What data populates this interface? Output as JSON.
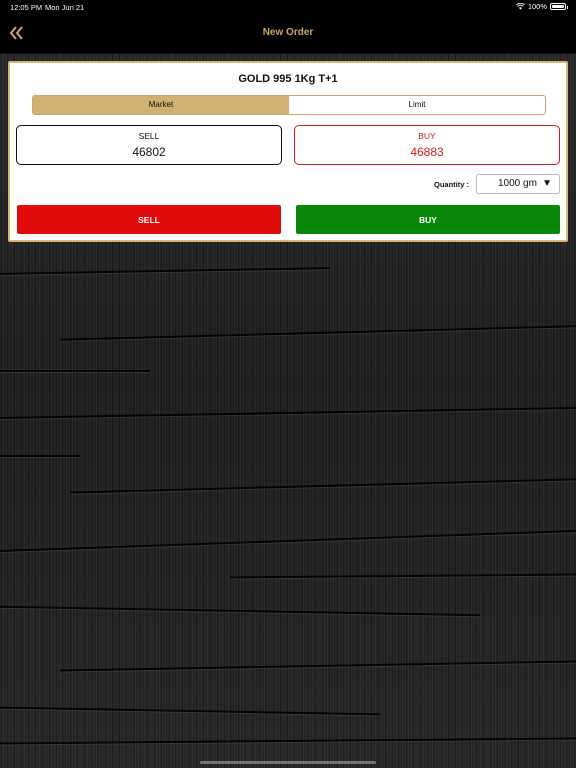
{
  "status_bar": {
    "time": "12:05 PM",
    "date": "Mon Jun 21",
    "battery": "100%"
  },
  "nav": {
    "title": "New Order",
    "back_icon": "double-chevron-left-icon"
  },
  "order": {
    "instrument": "GOLD 995 1Kg  T+1",
    "tabs": [
      {
        "label": "Market",
        "active": true
      },
      {
        "label": "Limit",
        "active": false
      }
    ],
    "sell": {
      "label": "SELL",
      "price": "46802"
    },
    "buy": {
      "label": "BUY",
      "price": "46883"
    },
    "quantity": {
      "label": "Quantity :",
      "value": "1000 gm",
      "arrow": "▼"
    },
    "sell_button": "SELL",
    "buy_button": "BUY"
  },
  "colors": {
    "accent": "#c9a96a",
    "sell": "#e00b0b",
    "buy": "#078608",
    "buy_text": "#d21c1c"
  }
}
